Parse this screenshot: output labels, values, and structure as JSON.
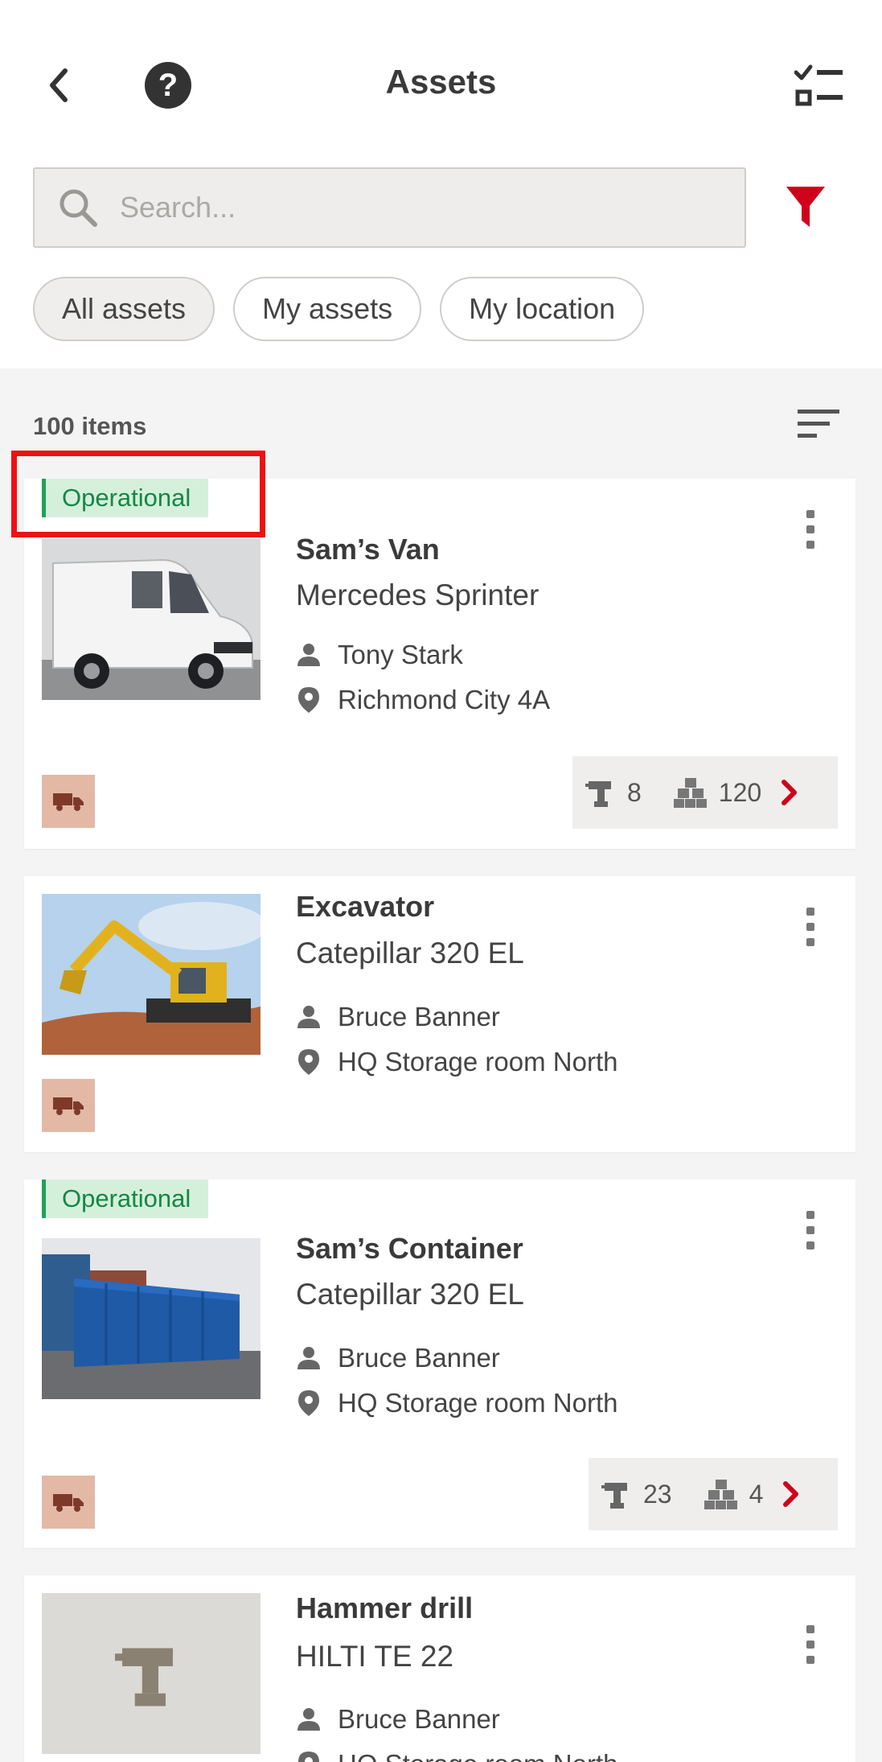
{
  "header": {
    "title": "Assets"
  },
  "search": {
    "placeholder": "Search..."
  },
  "chips": [
    {
      "label": "All assets",
      "active": true
    },
    {
      "label": "My assets",
      "active": false
    },
    {
      "label": "My location",
      "active": false
    }
  ],
  "list": {
    "count_label": "100 items",
    "items": [
      {
        "status": "Operational",
        "name": "Sam’s Van",
        "model": "Mercedes Sprinter",
        "owner": "Tony Stark",
        "location": "Richmond City 4A",
        "tools": "8",
        "materials": "120",
        "icon": "truck-icon"
      },
      {
        "name": "Excavator",
        "model": "Catepillar 320 EL",
        "owner": "Bruce Banner",
        "location": "HQ Storage room North",
        "icon": "truck-icon"
      },
      {
        "status": "Operational",
        "name": "Sam’s Container",
        "model": "Catepillar 320 EL",
        "owner": "Bruce Banner",
        "location": "HQ Storage room North",
        "tools": "23",
        "materials": "4",
        "icon": "truck-icon"
      },
      {
        "name": "Hammer drill",
        "model": "HILTI TE 22",
        "owner": "Bruce Banner",
        "location": "HQ Storage room North",
        "icon": "drill-icon"
      }
    ]
  },
  "colors": {
    "accent": "#d0021b",
    "operational_text": "#168645",
    "operational_bg": "#d4f0db",
    "type_badge": "#e3b9a6"
  }
}
